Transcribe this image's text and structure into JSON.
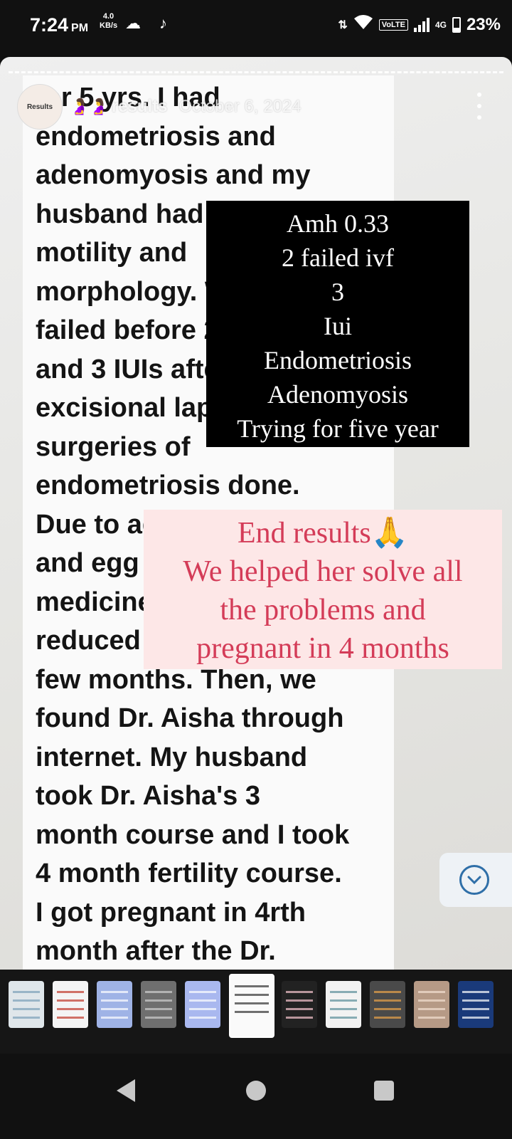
{
  "status_bar": {
    "time": "7:24",
    "ampm": "PM",
    "net_speed_value": "4.0",
    "net_speed_unit": "KB/s",
    "volte": "VoLTE",
    "network_type": "4G",
    "battery": "23%",
    "battery_level_fraction": 0.23
  },
  "story": {
    "avatar_label": "Results",
    "header_emojis": "🤰🤰",
    "username": "results",
    "date": "October 6, 2024",
    "chat_text": "for 5 yrs. I had\nendometriosis and\nadenomyosis and my\nhusband had low\nmotility and\nmorphology. We\nfailed before 2 IVF\nand 3 IUIs after\nexcisional lap\nsurgeries of\nendometriosis done.\nDue to age\nand egg quality\nmedicine\nreduced for\nfew months. Then, we\nfound Dr. Aisha through\ninternet. My husband\ntook Dr. Aisha's 3\nmonth course and I took\n4 month fertility course.\nI got pregnant in 4rth\nmonth after the Dr.",
    "overlay_black_lines": [
      "Amh 0.33",
      "2 failed ivf",
      "3",
      "Iui",
      "Endometriosis",
      "Adenomyosis",
      "Trying for five year"
    ],
    "overlay_pink_lines": [
      "End  results🙏",
      "We helped her solve all",
      "the problems and",
      "pregnant in 4 months"
    ]
  },
  "thumbnails": [
    {
      "bg": "#dfe6ea",
      "accent": "#7aa0b8"
    },
    {
      "bg": "#f4f4f4",
      "accent": "#c0392b"
    },
    {
      "bg": "#9fb3e6",
      "accent": "#ffffff"
    },
    {
      "bg": "#6f6f6f",
      "accent": "#cfcfcf"
    },
    {
      "bg": "#a9b8ef",
      "accent": "#ffffff"
    },
    {
      "bg": "#fafafa",
      "accent": "#333333"
    },
    {
      "bg": "#222222",
      "accent": "#f7c6cf"
    },
    {
      "bg": "#f2f2f2",
      "accent": "#5b8f9a"
    },
    {
      "bg": "#4a4a4a",
      "accent": "#e8a24a"
    },
    {
      "bg": "#b69a86",
      "accent": "#f3e0d2"
    },
    {
      "bg": "#1a3a7a",
      "accent": "#ffffff"
    }
  ],
  "active_thumbnail_index": 5
}
